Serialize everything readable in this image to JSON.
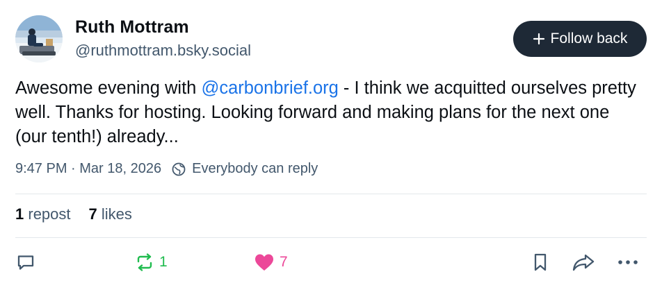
{
  "author": {
    "display_name": "Ruth Mottram",
    "handle": "@ruthmottram.bsky.social",
    "avatar_icon": "person-on-snow-avatar"
  },
  "follow_button": {
    "label": "Follow back",
    "icon": "plus-icon"
  },
  "post": {
    "text_before_mention": "Awesome evening with ",
    "mention": "@carbonbrief.org",
    "text_after_mention": " - I think we acquitted ourselves pretty well. Thanks for hosting. Looking forward and making plans for the next one (our tenth!) already...",
    "timestamp": "9:47 PM · Mar 18, 2026",
    "reply_setting": "Everybody can reply"
  },
  "counts": {
    "reposts_value": "1",
    "reposts_label": "repost",
    "likes_value": "7",
    "likes_label": "likes"
  },
  "actions": {
    "reply_icon": "comment-icon",
    "repost_count": "1",
    "like_count": "7",
    "bookmark_icon": "bookmark-icon",
    "share_icon": "share-icon",
    "more_icon": "more-icon"
  },
  "colors": {
    "accent_link": "#1a73e8",
    "repost_green": "#20bc4f",
    "like_pink": "#ec4899",
    "button_dark": "#1e2936",
    "muted_text": "#42576c"
  }
}
